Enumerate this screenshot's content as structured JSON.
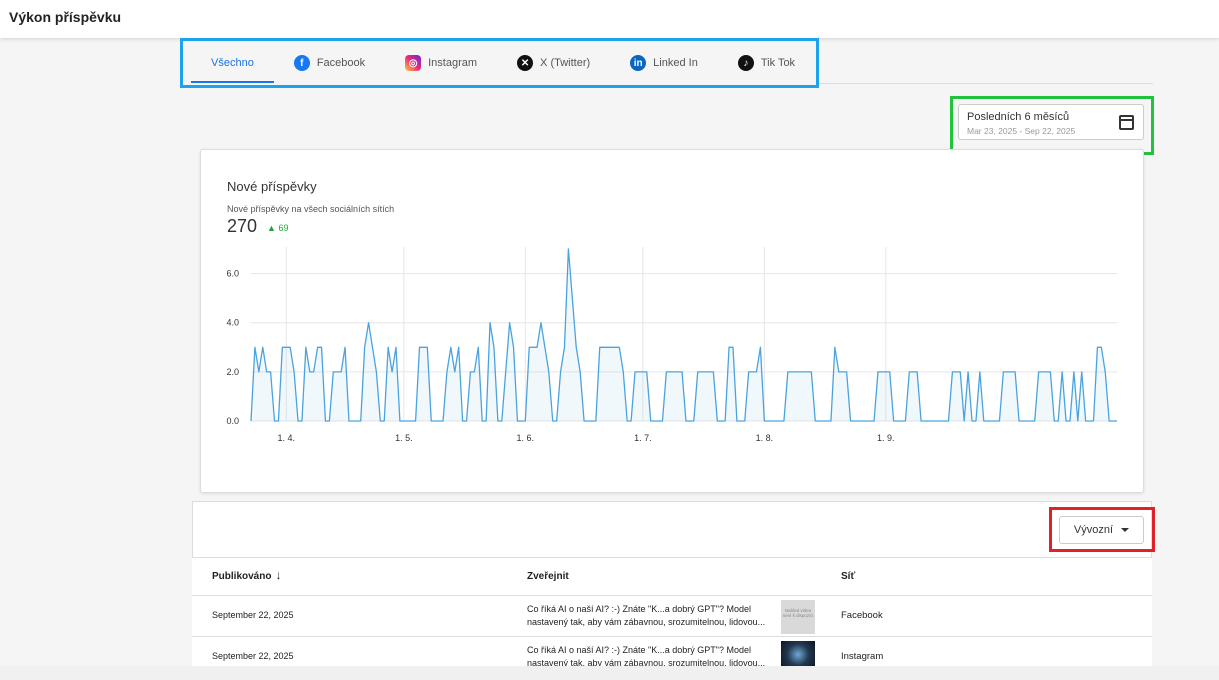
{
  "page": {
    "title": "Výkon příspěvku"
  },
  "tabs": [
    {
      "label": "Všechno",
      "icon": "",
      "active": true
    },
    {
      "label": "Facebook",
      "icon": "facebook-icon"
    },
    {
      "label": "Instagram",
      "icon": "instagram-icon"
    },
    {
      "label": "X (Twitter)",
      "icon": "x-icon"
    },
    {
      "label": "Linked In",
      "icon": "linkedin-icon"
    },
    {
      "label": "Tik Tok",
      "icon": "tiktok-icon"
    }
  ],
  "date_range": {
    "label": "Posledních 6 měsíců",
    "range": "Mar 23, 2025 - Sep 22, 2025",
    "icon": "calendar-icon"
  },
  "summary": {
    "title": "Nové příspěvky",
    "subtitle": "Nové příspěvky na všech sociálních sítích",
    "total": "270",
    "delta": "69",
    "delta_icon": "arrow-up-icon",
    "delta_color": "#22a33a"
  },
  "chart_data": {
    "type": "area",
    "color": "#4aa3df",
    "x_tick_labels": [
      "1. 4.",
      "1. 5.",
      "1. 6.",
      "1. 7.",
      "1. 8.",
      "1. 9."
    ],
    "y_tick_labels": [
      "0.0",
      "2.0",
      "4.0",
      "6.0"
    ],
    "ylim": [
      0,
      7
    ],
    "grid": true,
    "x_start": "2025-03-23",
    "values": [
      0,
      3,
      2,
      3,
      2,
      2,
      0,
      0,
      3,
      3,
      3,
      2,
      0,
      0,
      3,
      2,
      2,
      3,
      3,
      0,
      0,
      2,
      2,
      2,
      3,
      0,
      0,
      0,
      0,
      3,
      4,
      3,
      2,
      0,
      0,
      3,
      2,
      3,
      0,
      0,
      0,
      0,
      0,
      3,
      3,
      3,
      0,
      0,
      0,
      0,
      2,
      3,
      2,
      3,
      0,
      0,
      2,
      2,
      3,
      0,
      0,
      4,
      3,
      0,
      0,
      2,
      4,
      3,
      0,
      0,
      0,
      3,
      3,
      3,
      4,
      3,
      2,
      0,
      0,
      2,
      3,
      3,
      3,
      3,
      2,
      0,
      0,
      0,
      0,
      3,
      3,
      3,
      3,
      3,
      3,
      2,
      0,
      0,
      2,
      2,
      2,
      2,
      0,
      0,
      0,
      0,
      2,
      2,
      2,
      2,
      2,
      0,
      0,
      0,
      2,
      2,
      2,
      2,
      2,
      0,
      0,
      0,
      3,
      3,
      0,
      0,
      0,
      2,
      2,
      2,
      3,
      0,
      0,
      0,
      0,
      0,
      0,
      2,
      2,
      2,
      2,
      2,
      2,
      2,
      0,
      0,
      0,
      0,
      0,
      3,
      2,
      2,
      2,
      0,
      0,
      0,
      0,
      0,
      0,
      0,
      2,
      2,
      2,
      2,
      0,
      0,
      0,
      0,
      2,
      2,
      2,
      0,
      0,
      0,
      0,
      0,
      0,
      0,
      0,
      2,
      2,
      2,
      0,
      2,
      0,
      0,
      2,
      0,
      0,
      0,
      0,
      0,
      2,
      2,
      2,
      2,
      0,
      0,
      0,
      0,
      0,
      2,
      2,
      2,
      2,
      0,
      0,
      2,
      0,
      0,
      2,
      0,
      2,
      0,
      0,
      0,
      3,
      3,
      2,
      0,
      0,
      0
    ],
    "spikes": [
      {
        "date": "2025-06-12",
        "value": 7
      },
      {
        "date": "2025-06-13",
        "value": 5
      }
    ]
  },
  "export": {
    "label": "Vývozní"
  },
  "table": {
    "headers": {
      "published": "Publikováno",
      "post": "Zveřejnit",
      "network": "Síť"
    },
    "rows": [
      {
        "date": "September 22, 2025",
        "post": "Co říká AI o naší AI? :-) Znáte \"K...a dobrý GPT\"? Model nastavený tak, aby vám zábavnou, srozumitelnou, lidovou...",
        "network": "Facebook"
      },
      {
        "date": "September 22, 2025",
        "post": "Co říká AI o naší AI? :-) Znáte \"K...a dobrý GPT\"? Model nastavený tak, aby vám zábavnou, srozumitelnou, lidovou...",
        "network": "Instagram"
      }
    ]
  }
}
